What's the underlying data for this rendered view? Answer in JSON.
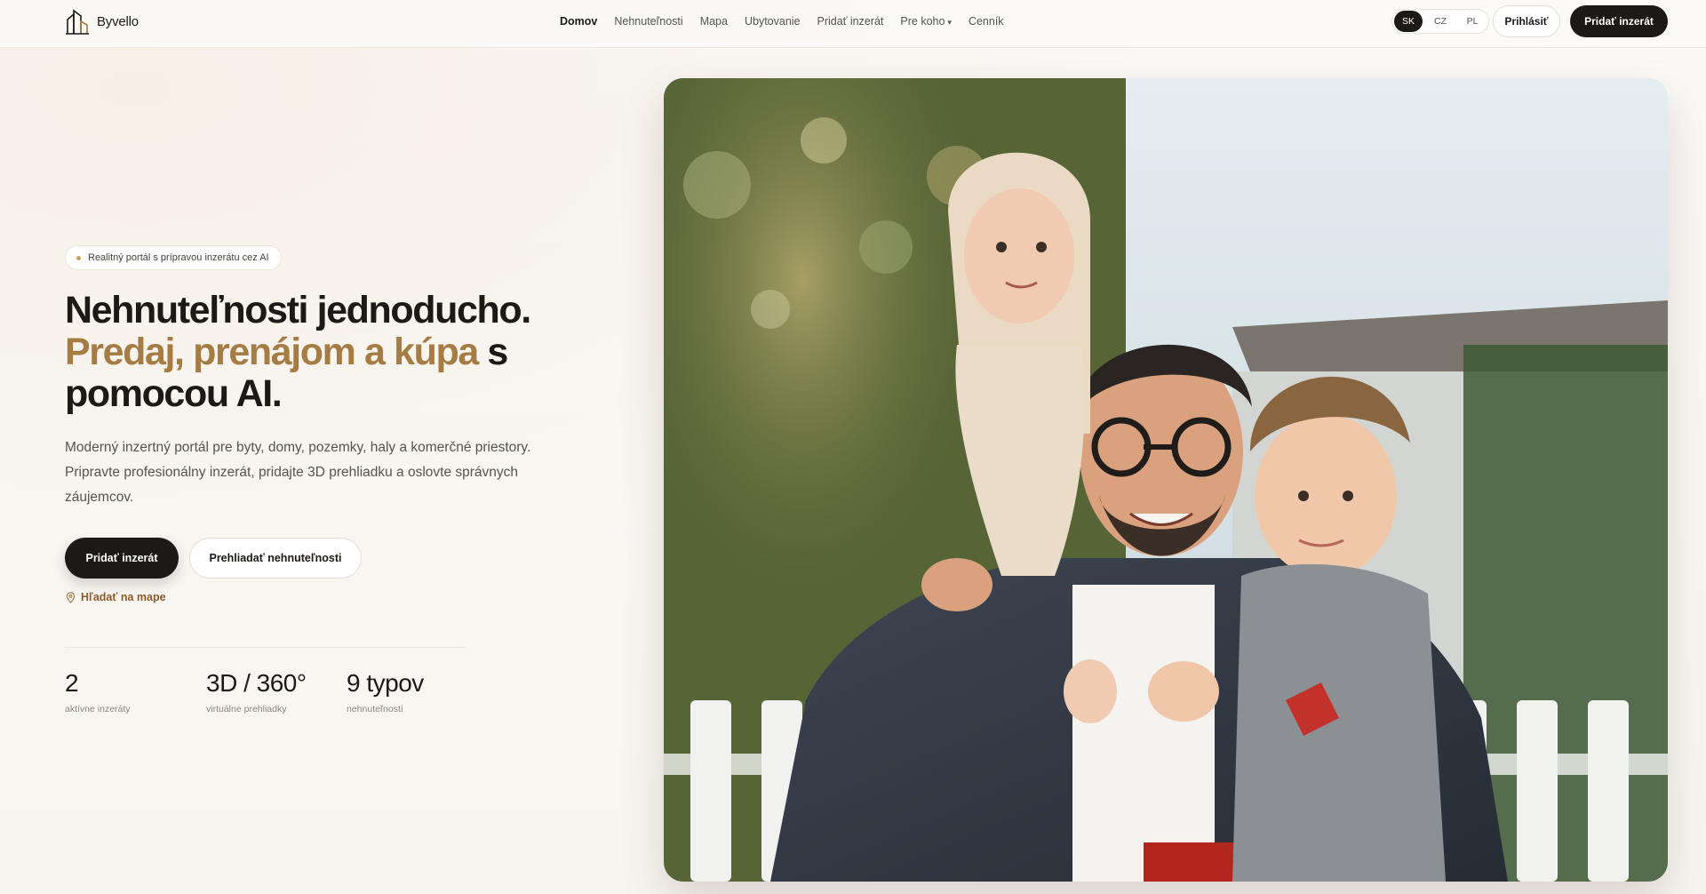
{
  "nav": {
    "brand": "Byvello",
    "links": [
      {
        "label": "Domov",
        "active": true
      },
      {
        "label": "Nehnuteľnosti"
      },
      {
        "label": "Mapa"
      },
      {
        "label": "Ubytovanie"
      },
      {
        "label": "Pridať inzerát"
      },
      {
        "label": "Pre koho",
        "dropdown": true
      },
      {
        "label": "Cenník"
      }
    ],
    "languages": [
      "SK",
      "CZ",
      "PL"
    ],
    "active_language": "SK",
    "login_label": "Prihlásiť",
    "add_listing_label": "Pridať inzerát"
  },
  "hero": {
    "badge": "Realitný portál s prípravou inzerátu cez AI",
    "headline_line1": "Nehnuteľnosti jednoducho.",
    "headline_accent": "Predaj, prenájom a kúpa",
    "headline_after_accent": " s",
    "headline_line3": "pomocou AI.",
    "description": "Moderný inzertný portál pre byty, domy, pozemky, haly a komerčné priestory. Pripravte profesionálny inzerát, pridajte 3D prehliadku a oslovte správnych záujemcov.",
    "primary_button": "Pridať inzerát",
    "secondary_button": "Prehliadať nehnuteľnosti",
    "map_link": "Hľadať na mape",
    "stats": [
      {
        "value": "2",
        "label": "aktívne inzeráty"
      },
      {
        "value": "3D / 360°",
        "label": "virtuálne prehliadky"
      },
      {
        "value": "9 typov",
        "label": "nehnuteľností"
      }
    ]
  },
  "colors": {
    "accent": "#a67c45",
    "dark": "#1c1917",
    "background": "#faf8f5"
  },
  "icons": {
    "logo": "building-logo-icon",
    "map": "map-pin-icon",
    "badge_dot": "dot-icon",
    "dropdown": "chevron-down-icon"
  }
}
